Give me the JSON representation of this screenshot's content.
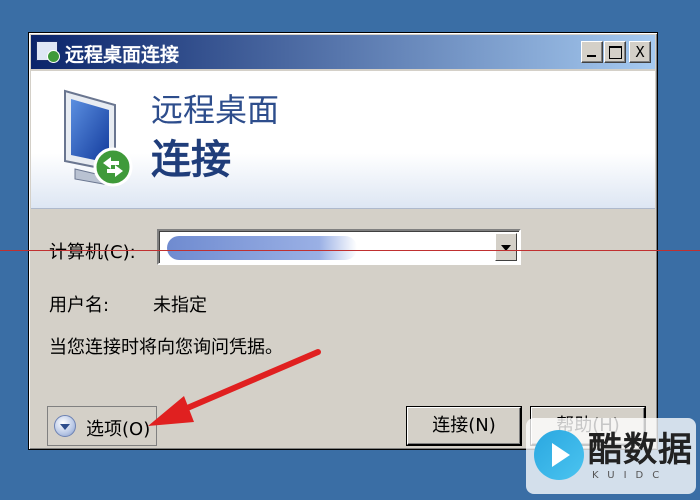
{
  "window": {
    "title": "远程桌面连接",
    "controls": [
      "minimize-icon",
      "maximize-icon",
      "close-icon"
    ],
    "close_glyph": "X"
  },
  "banner": {
    "line1": "远程桌面",
    "line2": "连接"
  },
  "form": {
    "computer_label": "计算机(C):",
    "computer_value": "",
    "username_label": "用户名:",
    "username_value": "未指定",
    "note": "当您连接时将向您询问凭据。"
  },
  "buttons": {
    "options": "选项(O)",
    "connect": "连接(N)",
    "help": "帮助(H)"
  },
  "watermark": {
    "text": "酷数据",
    "sub": "KUIDC"
  },
  "colors": {
    "desktop": "#3a6ea5",
    "titlebar_start": "#0a246a",
    "titlebar_end": "#a6caf0",
    "window_face": "#d4d0c8",
    "annotation_arrow": "#e02020"
  }
}
